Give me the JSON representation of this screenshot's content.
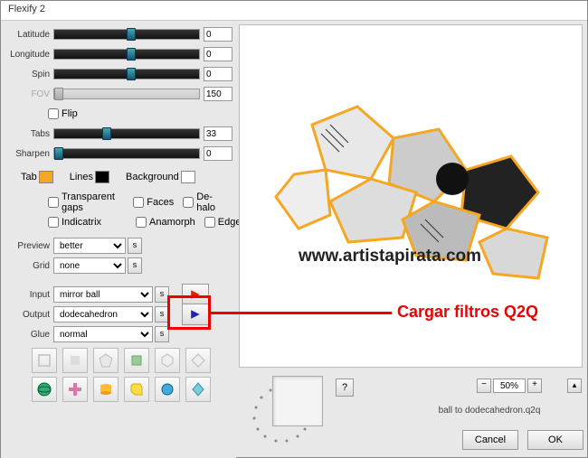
{
  "window": {
    "title": "Flexify 2"
  },
  "sliders": {
    "latitude": {
      "label": "Latitude",
      "value": "0",
      "thumb_pct": 50
    },
    "longitude": {
      "label": "Longitude",
      "value": "0",
      "thumb_pct": 50
    },
    "spin": {
      "label": "Spin",
      "value": "0",
      "thumb_pct": 50
    },
    "fov": {
      "label": "FOV",
      "value": "150",
      "thumb_pct": 0
    },
    "tabs": {
      "label": "Tabs",
      "value": "33",
      "thumb_pct": 33
    },
    "sharpen": {
      "label": "Sharpen",
      "value": "0",
      "thumb_pct": 0
    }
  },
  "checks": {
    "flip": "Flip",
    "transparent_gaps": "Transparent gaps",
    "faces": "Faces",
    "dehalo": "De-halo",
    "indicatrix": "Indicatrix",
    "anamorph": "Anamorph",
    "edges": "Edges"
  },
  "colors": {
    "tab_label": "Tab",
    "tab_color": "#f5a623",
    "lines_label": "Lines",
    "lines_color": "#000000",
    "background_label": "Background",
    "background_color": "#ffffff"
  },
  "selects": {
    "preview_label": "Preview",
    "preview_value": "better",
    "grid_label": "Grid",
    "grid_value": "none",
    "input_label": "Input",
    "input_value": "mirror ball",
    "output_label": "Output",
    "output_value": "dodecahedron",
    "glue_label": "Glue",
    "glue_value": "normal"
  },
  "zoom": {
    "value": "50%"
  },
  "status": "ball to dodecahedron.q2q",
  "buttons": {
    "help": "?",
    "cancel": "Cancel",
    "ok": "OK"
  },
  "watermark": "www.artistapirata.com",
  "annotation": "Cargar filtros Q2Q"
}
